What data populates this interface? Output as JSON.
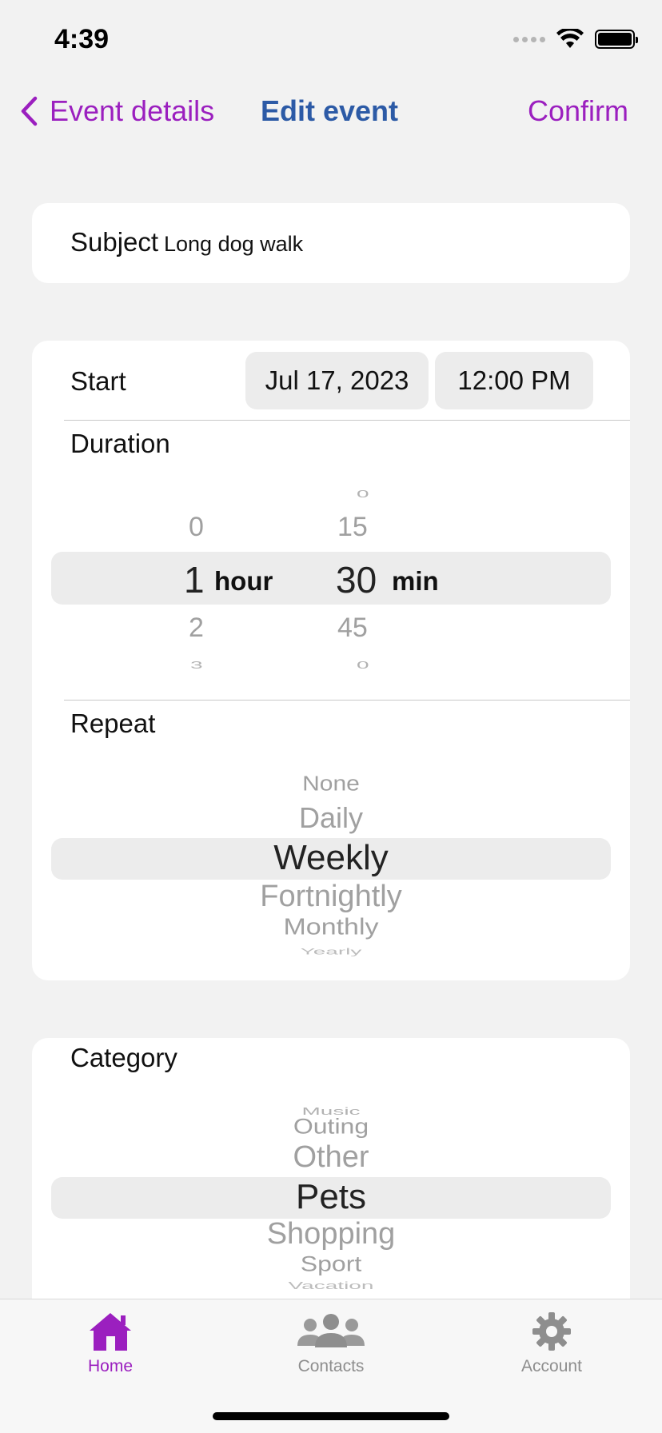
{
  "status_bar": {
    "time": "4:39"
  },
  "nav": {
    "back_label": "Event details",
    "title": "Edit event",
    "confirm_label": "Confirm"
  },
  "subject": {
    "label": "Subject",
    "value": "Long dog walk"
  },
  "start": {
    "label": "Start",
    "date": "Jul 17, 2023",
    "time": "12:00 PM"
  },
  "duration": {
    "label": "Duration",
    "hours": [
      "0",
      "1",
      "2",
      "3"
    ],
    "selected_hour": "1",
    "hour_unit": "hour",
    "minutes": [
      "0",
      "15",
      "30",
      "45",
      "0"
    ],
    "selected_minute": "30",
    "minute_unit": "min"
  },
  "repeat": {
    "label": "Repeat",
    "options": [
      "None",
      "Daily",
      "Weekly",
      "Fortnightly",
      "Monthly",
      "Yearly"
    ],
    "selected": "Weekly"
  },
  "category": {
    "label": "Category",
    "options": [
      "Music",
      "Outing",
      "Other",
      "Pets",
      "Shopping",
      "Sport",
      "Vacation"
    ],
    "selected": "Pets"
  },
  "tabs": [
    {
      "label": "Home",
      "icon": "house-icon",
      "active": true
    },
    {
      "label": "Contacts",
      "icon": "people-icon",
      "active": false
    },
    {
      "label": "Account",
      "icon": "gear-icon",
      "active": false
    }
  ],
  "colors": {
    "accent": "#9b1fbf",
    "title": "#2c5aa6",
    "inactive": "#8e8e8e"
  }
}
